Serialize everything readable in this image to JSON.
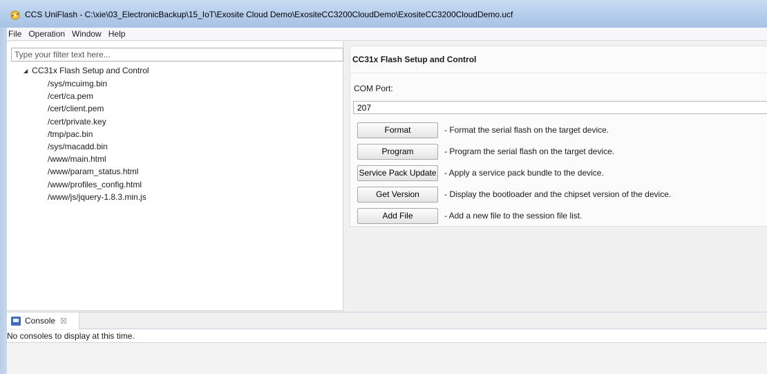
{
  "window": {
    "title": "CCS UniFlash - C:\\xie\\03_ElectronicBackup\\15_IoT\\Exosite Cloud Demo\\ExositeCC3200CloudDemo\\ExositeCC3200CloudDemo.ucf",
    "icon": "uniflash-app-icon"
  },
  "menu": [
    "File",
    "Operation",
    "Window",
    "Help"
  ],
  "filter": {
    "placeholder": "Type your filter text here..."
  },
  "tree": {
    "root": "CC31x Flash Setup and Control",
    "files": [
      "/sys/mcuimg.bin",
      "/cert/ca.pem",
      "/cert/client.pem",
      "/cert/private.key",
      "/tmp/pac.bin",
      "/sys/macadd.bin",
      "/www/main.html",
      "/www/param_status.html",
      "/www/profiles_config.html",
      "/www/js/jquery-1.8.3.min.js"
    ]
  },
  "panel": {
    "title": "CC31x Flash Setup and Control",
    "com_port_label": "COM Port:",
    "com_port_value": "207",
    "actions": [
      {
        "label": "Format",
        "description": "- Format the serial flash on the target device."
      },
      {
        "label": "Program",
        "description": "- Program the serial flash on the target device."
      },
      {
        "label": "Service Pack Update",
        "description": "- Apply a service pack bundle to the device."
      },
      {
        "label": "Get Version",
        "description": "- Display the bootloader and the chipset version of the device."
      },
      {
        "label": "Add File",
        "description": "- Add a new file to the session file list."
      }
    ]
  },
  "console": {
    "tab_label": "Console",
    "close_symbol": "☒",
    "message": "No consoles to display at this time."
  }
}
